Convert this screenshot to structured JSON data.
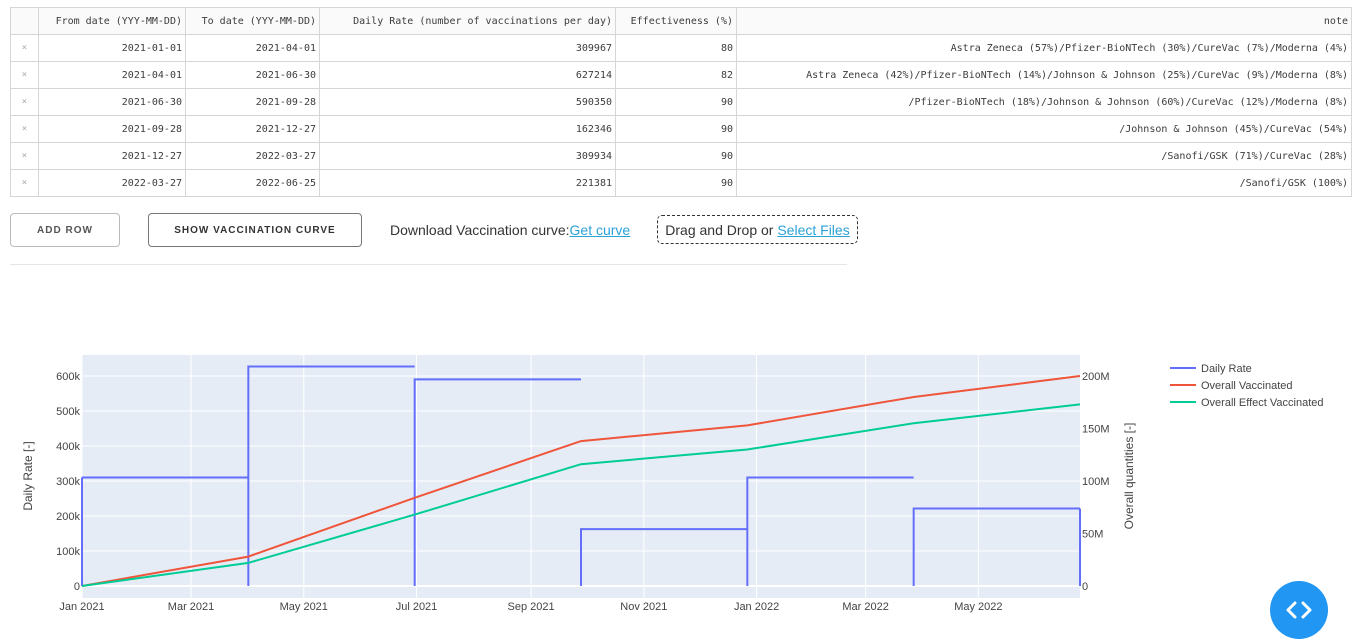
{
  "table": {
    "columns": [
      "From date (YYY-MM-DD)",
      "To date (YYY-MM-DD)",
      "Daily Rate (number of vaccinations per day)",
      "Effectiveness (%)",
      "note"
    ],
    "delete_glyph": "×",
    "rows": [
      [
        "2021-01-01",
        "2021-04-01",
        "309967",
        "80",
        "Astra Zeneca (57%)/Pfizer-BioNTech (30%)/CureVac (7%)/Moderna (4%)"
      ],
      [
        "2021-04-01",
        "2021-06-30",
        "627214",
        "82",
        "Astra Zeneca (42%)/Pfizer-BioNTech (14%)/Johnson & Johnson (25%)/CureVac (9%)/Moderna (8%)"
      ],
      [
        "2021-06-30",
        "2021-09-28",
        "590350",
        "90",
        "/Pfizer-BioNTech (18%)/Johnson & Johnson (60%)/CureVac (12%)/Moderna (8%)"
      ],
      [
        "2021-09-28",
        "2021-12-27",
        "162346",
        "90",
        "/Johnson & Johnson (45%)/CureVac (54%)"
      ],
      [
        "2021-12-27",
        "2022-03-27",
        "309934",
        "90",
        "/Sanofi/GSK (71%)/CureVac (28%)"
      ],
      [
        "2022-03-27",
        "2022-06-25",
        "221381",
        "90",
        "/Sanofi/GSK (100%)"
      ]
    ]
  },
  "buttons": {
    "add_row": "ADD ROW",
    "show_curve": "SHOW VACCINATION CURVE"
  },
  "download": {
    "label": "Download Vaccination curve:",
    "link": "Get curve"
  },
  "upload": {
    "label": "Drag and Drop or ",
    "link": "Select Files"
  },
  "fab_icon": "code-arrows-icon",
  "chart_data": {
    "type": "line",
    "ylabel": "Daily Rate [-]",
    "y2label": "Overall quantities [-]",
    "ylim": [
      0,
      660000
    ],
    "y2lim": [
      0,
      220000000
    ],
    "y_ticks": [
      "0",
      "100k",
      "200k",
      "300k",
      "400k",
      "500k",
      "600k"
    ],
    "y2_ticks": [
      "0",
      "50M",
      "100M",
      "150M",
      "200M"
    ],
    "x_ticks": [
      "Jan 2021",
      "Mar 2021",
      "May 2021",
      "Jul 2021",
      "Sep 2021",
      "Nov 2021",
      "Jan 2022",
      "Mar 2022",
      "May 2022"
    ],
    "x_tick_dates": [
      "2021-01-01",
      "2021-03-01",
      "2021-05-01",
      "2021-07-01",
      "2021-09-01",
      "2021-11-01",
      "2022-01-01",
      "2022-03-01",
      "2022-05-01"
    ],
    "xlim": [
      "2021-01-01",
      "2022-06-25"
    ],
    "grid": true,
    "legend_position": "top-right",
    "colors": {
      "Daily Rate": "#636efa",
      "Overall Vaccinated": "#ef553b",
      "Overall Effect Vaccinated": "#00cc96",
      "plot_bg": "#e5ecf6"
    },
    "series": [
      {
        "name": "Daily Rate",
        "axis": "y",
        "shape": "step",
        "x": [
          "2021-01-01",
          "2021-04-01",
          "2021-04-01",
          "2021-06-30",
          "2021-06-30",
          "2021-09-28",
          "2021-09-28",
          "2021-12-27",
          "2021-12-27",
          "2022-03-27",
          "2022-03-27",
          "2022-06-25"
        ],
        "y": [
          309967,
          309967,
          627214,
          627214,
          590350,
          590350,
          162346,
          162346,
          309934,
          309934,
          221381,
          221381
        ]
      },
      {
        "name": "Overall Vaccinated",
        "axis": "y2",
        "x": [
          "2021-01-01",
          "2021-04-01",
          "2021-06-30",
          "2021-09-28",
          "2021-12-27",
          "2022-03-27",
          "2022-06-25"
        ],
        "y": [
          0,
          28000000,
          84000000,
          138000000,
          153000000,
          180000000,
          200000000
        ]
      },
      {
        "name": "Overall Effect Vaccinated",
        "axis": "y2",
        "x": [
          "2021-01-01",
          "2021-04-01",
          "2021-06-30",
          "2021-09-28",
          "2021-12-27",
          "2022-03-27",
          "2022-06-25"
        ],
        "y": [
          0,
          22000000,
          68000000,
          116000000,
          130000000,
          155000000,
          173000000
        ]
      }
    ]
  }
}
